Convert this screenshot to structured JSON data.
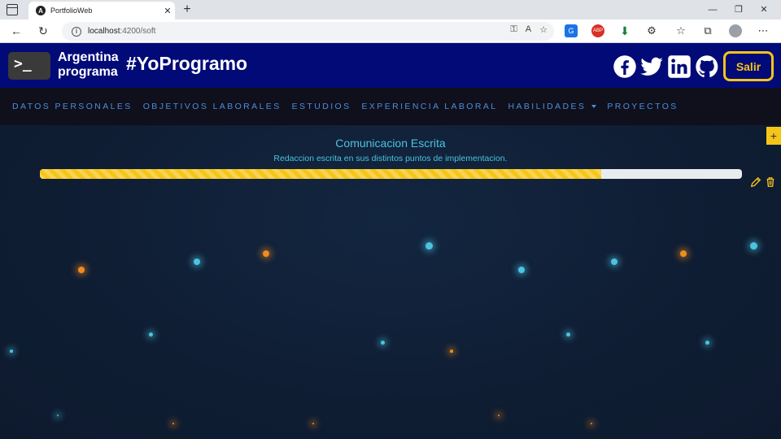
{
  "browser": {
    "tab_title": "PortfolioWeb",
    "url_host": "localhost",
    "url_rest": ":4200/soft"
  },
  "header": {
    "logo_symbol": ">_",
    "brand_line1": "Argentina",
    "brand_line2": "programa",
    "hashtag": "#YoProgramo",
    "social_icons": [
      "facebook-icon",
      "twitter-icon",
      "linkedin-icon",
      "github-icon"
    ],
    "logout_label": "Salir"
  },
  "nav": {
    "items": [
      "DATOS PERSONALES",
      "OBJETIVOS LABORALES",
      "ESTUDIOS",
      "EXPERIENCIA LABORAL",
      "HABILIDADES",
      "PROYECTOS"
    ]
  },
  "skill": {
    "title": "Comunicacion Escrita",
    "description": "Redaccion escrita en sus distintos puntos de implementacion.",
    "progress_percent": 80
  },
  "colors": {
    "header_bg": "#020a78",
    "accent": "#f5c518",
    "nav_text": "#4a8fd9",
    "skill_text": "#4cc3e0",
    "background": "#0f1d33"
  }
}
